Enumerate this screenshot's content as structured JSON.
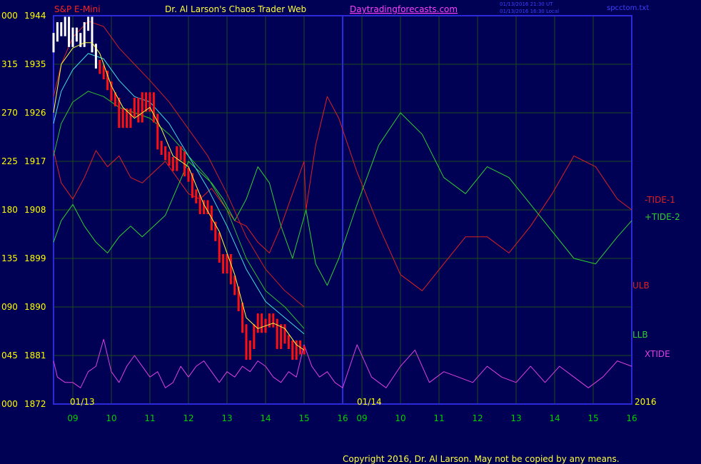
{
  "header": {
    "instrument": "S&P E-Mini",
    "site_title": "Dr. Al Larson's Chaos Trader Web",
    "site_link": "Daytradingforecasts.com",
    "stamp_line1": "01/13/2016 21:30 UT",
    "stamp_line2": "01/13/2016 16:30 Local",
    "filename": "spcctom.txt"
  },
  "footer": {
    "copyright": "Copyright 2016, Dr. Al Larson. May not be copied by any means."
  },
  "colors": {
    "background": "#000055",
    "grid": "#1e4a1e",
    "axis": "#2a2ad8",
    "price_white": "#ffffff",
    "price_red": "#ff1010",
    "ma_fast": "#ffff40",
    "ma_cyan": "#40e0e0",
    "ma_green": "#30c030",
    "ulb": "#d02020",
    "tide1": "#e02020",
    "tide2": "#30d030",
    "xtide": "#e040e0",
    "label_yellow": "#ffff00",
    "label_green": "#00d000"
  },
  "chart_data": {
    "type": "line",
    "title": "S&P E-Mini",
    "y_left_labels": [
      "000",
      "315",
      "270",
      "225",
      "180",
      "135",
      "090",
      "045",
      "000"
    ],
    "y_price_labels": [
      "1944",
      "1935",
      "1926",
      "1917",
      "1908",
      "1899",
      "1890",
      "1881",
      "1872"
    ],
    "y_range": [
      1872,
      1944
    ],
    "x_range": [
      8.5,
      16
    ],
    "x_ticks": [
      9,
      10,
      11,
      12,
      13,
      14,
      15,
      16
    ],
    "x_tick_labels": [
      "09",
      "10",
      "11",
      "12",
      "13",
      "14",
      "15",
      "16"
    ],
    "x_ticks_right": [
      9,
      10,
      11,
      12,
      13,
      14,
      15,
      16
    ],
    "x_tick_labels_right": [
      "09",
      "10",
      "11",
      "12",
      "13",
      "14",
      "15",
      "16"
    ],
    "date_left": "01/13",
    "date_right": "01/14",
    "year_label": "2016",
    "series_labels": {
      "tide1": "-TIDE-1",
      "tide2": "+TIDE-2",
      "ulb": "ULB",
      "llb": "LLB",
      "xtide": "XTIDE"
    },
    "price_path": [
      [
        8.5,
        1938
      ],
      [
        8.6,
        1940
      ],
      [
        8.7,
        1942
      ],
      [
        8.8,
        1941
      ],
      [
        8.9,
        1943
      ],
      [
        9.0,
        1939
      ],
      [
        9.1,
        1941
      ],
      [
        9.2,
        1940
      ],
      [
        9.3,
        1939
      ],
      [
        9.4,
        1942
      ],
      [
        9.5,
        1943
      ],
      [
        9.6,
        1938
      ],
      [
        9.7,
        1935
      ],
      [
        9.8,
        1934
      ],
      [
        9.9,
        1933
      ],
      [
        10.0,
        1931
      ],
      [
        10.1,
        1929
      ],
      [
        10.2,
        1928
      ],
      [
        10.3,
        1924
      ],
      [
        10.4,
        1926
      ],
      [
        10.5,
        1924
      ],
      [
        10.6,
        1926
      ],
      [
        10.7,
        1928
      ],
      [
        10.8,
        1925
      ],
      [
        10.9,
        1929
      ],
      [
        11.0,
        1927
      ],
      [
        11.1,
        1929
      ],
      [
        11.2,
        1925
      ],
      [
        11.3,
        1920
      ],
      [
        11.4,
        1919
      ],
      [
        11.5,
        1918
      ],
      [
        11.6,
        1917
      ],
      [
        11.7,
        1916
      ],
      [
        11.8,
        1919
      ],
      [
        11.9,
        1918
      ],
      [
        12.0,
        1915
      ],
      [
        12.1,
        1914
      ],
      [
        12.2,
        1911
      ],
      [
        12.3,
        1910
      ],
      [
        12.4,
        1908
      ],
      [
        12.5,
        1909
      ],
      [
        12.6,
        1908
      ],
      [
        12.7,
        1905
      ],
      [
        12.8,
        1903
      ],
      [
        12.9,
        1899
      ],
      [
        13.0,
        1897
      ],
      [
        13.1,
        1899
      ],
      [
        13.2,
        1895
      ],
      [
        13.3,
        1893
      ],
      [
        13.4,
        1890
      ],
      [
        13.5,
        1886
      ],
      [
        13.6,
        1881
      ],
      [
        13.7,
        1883
      ],
      [
        13.8,
        1886
      ],
      [
        13.9,
        1888
      ],
      [
        14.0,
        1886
      ],
      [
        14.1,
        1887
      ],
      [
        14.2,
        1888
      ],
      [
        14.3,
        1887
      ],
      [
        14.4,
        1883
      ],
      [
        14.5,
        1886
      ],
      [
        14.6,
        1884
      ],
      [
        14.7,
        1883
      ],
      [
        14.8,
        1881
      ],
      [
        14.9,
        1883
      ],
      [
        15.0,
        1882
      ]
    ],
    "white_until": 9.7,
    "ma_fast": [
      [
        8.5,
        1926
      ],
      [
        8.7,
        1935
      ],
      [
        9.0,
        1938
      ],
      [
        9.3,
        1939
      ],
      [
        9.5,
        1939
      ],
      [
        9.7,
        1937
      ],
      [
        10.0,
        1931
      ],
      [
        10.3,
        1927
      ],
      [
        10.6,
        1925
      ],
      [
        11.0,
        1927
      ],
      [
        11.3,
        1923
      ],
      [
        11.6,
        1918
      ],
      [
        12.0,
        1916
      ],
      [
        12.4,
        1909
      ],
      [
        12.8,
        1904
      ],
      [
        13.2,
        1896
      ],
      [
        13.5,
        1888
      ],
      [
        13.8,
        1886
      ],
      [
        14.2,
        1887
      ],
      [
        14.5,
        1886
      ],
      [
        14.8,
        1883
      ],
      [
        15.0,
        1882
      ]
    ],
    "ma_cyan": [
      [
        8.5,
        1924
      ],
      [
        8.7,
        1930
      ],
      [
        9.0,
        1934
      ],
      [
        9.4,
        1937
      ],
      [
        9.8,
        1936
      ],
      [
        10.2,
        1932
      ],
      [
        10.6,
        1929
      ],
      [
        11.0,
        1928
      ],
      [
        11.5,
        1924
      ],
      [
        12.0,
        1918
      ],
      [
        12.5,
        1912
      ],
      [
        13.0,
        1905
      ],
      [
        13.5,
        1897
      ],
      [
        14.0,
        1891
      ],
      [
        14.5,
        1888
      ],
      [
        15.0,
        1885
      ]
    ],
    "ma_green": [
      [
        8.5,
        1918
      ],
      [
        8.7,
        1924
      ],
      [
        9.0,
        1928
      ],
      [
        9.4,
        1930
      ],
      [
        9.8,
        1929
      ],
      [
        10.2,
        1927
      ],
      [
        10.6,
        1926
      ],
      [
        11.0,
        1925
      ],
      [
        11.5,
        1922
      ],
      [
        12.0,
        1918
      ],
      [
        12.5,
        1914
      ],
      [
        13.0,
        1908
      ],
      [
        13.5,
        1899
      ],
      [
        14.0,
        1893
      ],
      [
        14.5,
        1890
      ],
      [
        15.0,
        1886
      ]
    ],
    "ulb": [
      [
        8.5,
        1929
      ],
      [
        8.7,
        1935
      ],
      [
        9.0,
        1940
      ],
      [
        9.4,
        1943
      ],
      [
        9.8,
        1942
      ],
      [
        10.2,
        1938
      ],
      [
        10.6,
        1935
      ],
      [
        11.0,
        1932
      ],
      [
        11.5,
        1928
      ],
      [
        12.0,
        1923
      ],
      [
        12.5,
        1918
      ],
      [
        13.0,
        1911
      ],
      [
        13.5,
        1903
      ],
      [
        14.0,
        1897
      ],
      [
        14.5,
        1893
      ],
      [
        15.0,
        1890
      ]
    ],
    "tide1": [
      [
        8.5,
        1919
      ],
      [
        8.7,
        1913
      ],
      [
        9.0,
        1910
      ],
      [
        9.3,
        1914
      ],
      [
        9.6,
        1919
      ],
      [
        9.9,
        1916
      ],
      [
        10.2,
        1918
      ],
      [
        10.5,
        1914
      ],
      [
        10.8,
        1913
      ],
      [
        11.1,
        1915
      ],
      [
        11.4,
        1917
      ],
      [
        11.7,
        1914
      ],
      [
        12.0,
        1911
      ],
      [
        12.3,
        1910
      ],
      [
        12.6,
        1912
      ],
      [
        12.9,
        1909
      ],
      [
        13.2,
        1906
      ],
      [
        13.5,
        1905
      ],
      [
        13.8,
        1902
      ],
      [
        14.1,
        1900
      ],
      [
        14.4,
        1905
      ],
      [
        14.7,
        1911
      ],
      [
        15.0,
        1917
      ],
      [
        15.05,
        1908
      ],
      [
        15.3,
        1920
      ],
      [
        15.6,
        1929
      ],
      [
        15.9,
        1925
      ],
      [
        16.2,
        1915
      ],
      [
        16.5,
        1905
      ],
      [
        16.8,
        1896
      ],
      [
        17.1,
        1893
      ],
      [
        17.4,
        1898
      ],
      [
        17.7,
        1903
      ],
      [
        18.0,
        1903
      ],
      [
        18.3,
        1900
      ],
      [
        18.6,
        1905
      ],
      [
        18.9,
        1911
      ],
      [
        19.2,
        1918
      ],
      [
        19.5,
        1916
      ],
      [
        19.8,
        1910
      ],
      [
        20.0,
        1908
      ]
    ],
    "tide2": [
      [
        8.5,
        1902
      ],
      [
        8.7,
        1906
      ],
      [
        9.0,
        1909
      ],
      [
        9.3,
        1905
      ],
      [
        9.6,
        1902
      ],
      [
        9.9,
        1900
      ],
      [
        10.2,
        1903
      ],
      [
        10.5,
        1905
      ],
      [
        10.8,
        1903
      ],
      [
        11.1,
        1905
      ],
      [
        11.4,
        1907
      ],
      [
        11.7,
        1912
      ],
      [
        12.0,
        1917
      ],
      [
        12.3,
        1915
      ],
      [
        12.6,
        1913
      ],
      [
        12.9,
        1910
      ],
      [
        13.2,
        1906
      ],
      [
        13.5,
        1910
      ],
      [
        13.8,
        1916
      ],
      [
        14.1,
        1913
      ],
      [
        14.4,
        1905
      ],
      [
        14.7,
        1899
      ],
      [
        15.05,
        1908
      ],
      [
        15.3,
        1898
      ],
      [
        15.6,
        1894
      ],
      [
        15.9,
        1899
      ],
      [
        16.2,
        1909
      ],
      [
        16.5,
        1920
      ],
      [
        16.8,
        1926
      ],
      [
        17.1,
        1922
      ],
      [
        17.4,
        1914
      ],
      [
        17.7,
        1911
      ],
      [
        18.0,
        1916
      ],
      [
        18.3,
        1914
      ],
      [
        18.6,
        1909
      ],
      [
        18.9,
        1904
      ],
      [
        19.2,
        1899
      ],
      [
        19.5,
        1898
      ],
      [
        19.8,
        1903
      ],
      [
        20.0,
        1906
      ]
    ],
    "xtide": [
      [
        8.5,
        1880
      ],
      [
        8.6,
        1877
      ],
      [
        8.8,
        1876
      ],
      [
        9.0,
        1876
      ],
      [
        9.2,
        1875
      ],
      [
        9.4,
        1878
      ],
      [
        9.6,
        1879
      ],
      [
        9.8,
        1884
      ],
      [
        10.0,
        1878
      ],
      [
        10.2,
        1876
      ],
      [
        10.4,
        1879
      ],
      [
        10.6,
        1881
      ],
      [
        10.8,
        1879
      ],
      [
        11.0,
        1877
      ],
      [
        11.2,
        1878
      ],
      [
        11.4,
        1875
      ],
      [
        11.6,
        1876
      ],
      [
        11.8,
        1879
      ],
      [
        12.0,
        1877
      ],
      [
        12.2,
        1879
      ],
      [
        12.4,
        1880
      ],
      [
        12.6,
        1878
      ],
      [
        12.8,
        1876
      ],
      [
        13.0,
        1878
      ],
      [
        13.2,
        1877
      ],
      [
        13.4,
        1879
      ],
      [
        13.6,
        1878
      ],
      [
        13.8,
        1880
      ],
      [
        14.0,
        1879
      ],
      [
        14.2,
        1877
      ],
      [
        14.4,
        1876
      ],
      [
        14.6,
        1878
      ],
      [
        14.8,
        1877
      ],
      [
        15.0,
        1883
      ],
      [
        15.2,
        1879
      ],
      [
        15.4,
        1877
      ],
      [
        15.6,
        1878
      ],
      [
        15.8,
        1876
      ],
      [
        16.0,
        1875
      ],
      [
        16.2,
        1883
      ],
      [
        16.4,
        1877
      ],
      [
        16.6,
        1875
      ],
      [
        16.8,
        1879
      ],
      [
        17.0,
        1882
      ],
      [
        17.2,
        1876
      ],
      [
        17.4,
        1878
      ],
      [
        17.6,
        1877
      ],
      [
        17.8,
        1876
      ],
      [
        18.0,
        1879
      ],
      [
        18.2,
        1877
      ],
      [
        18.4,
        1876
      ],
      [
        18.6,
        1879
      ],
      [
        18.8,
        1876
      ],
      [
        19.0,
        1879
      ],
      [
        19.2,
        1877
      ],
      [
        19.4,
        1875
      ],
      [
        19.6,
        1877
      ],
      [
        19.8,
        1880
      ],
      [
        20.0,
        1879
      ]
    ]
  }
}
